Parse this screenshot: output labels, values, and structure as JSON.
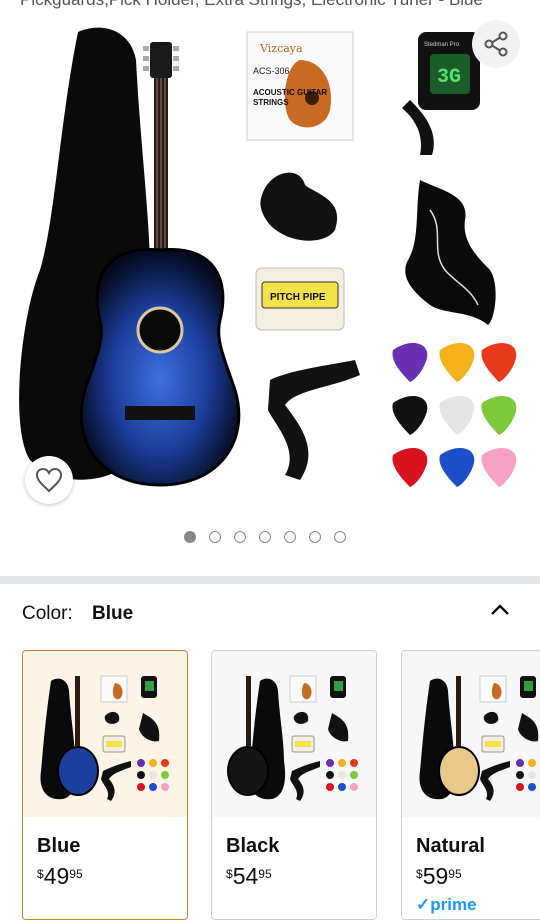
{
  "product": {
    "title_fragment": "Pickguards,Pick Holder, Extra Strings, Electronic Tuner - Blue"
  },
  "gallery": {
    "strings_brand": "Vizcaya",
    "strings_model": "ACS-306",
    "strings_label_line1": "ACOUSTIC GUITAR",
    "strings_label_line2": "STRINGS",
    "pitch_pipe_label": "PITCH PIPE",
    "tuner_brand": "Stedman Pro",
    "tuner_display": "3G",
    "page_count": 7,
    "active_page": 1
  },
  "variation": {
    "label": "Color:",
    "selected": "Blue"
  },
  "options": [
    {
      "name": "Blue",
      "currency": "$",
      "whole": "49",
      "fraction": "95",
      "body_color": "#1b3f9c"
    },
    {
      "name": "Black",
      "currency": "$",
      "whole": "54",
      "fraction": "95",
      "body_color": "#151515"
    },
    {
      "name": "Natural",
      "currency": "$",
      "whole": "59",
      "fraction": "95",
      "body_color": "#e8c98a",
      "badge": "✓prime"
    }
  ],
  "colors": {
    "selected_border": "#c7852a",
    "prime_blue": "#1a98ff",
    "divider": "#e3e6e6"
  }
}
